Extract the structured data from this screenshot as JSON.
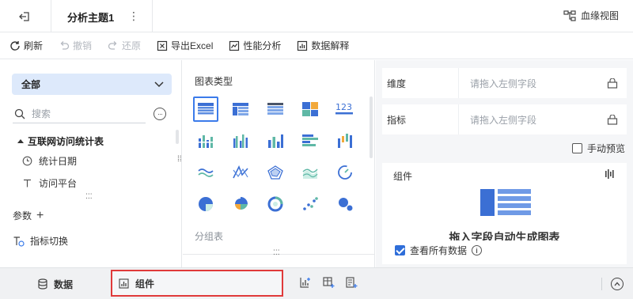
{
  "header": {
    "subject_title": "分析主题1",
    "lineage_label": "血缘视图"
  },
  "toolbar": {
    "refresh": "刷新",
    "undo": "撤销",
    "redo": "还原",
    "export_excel": "导出Excel",
    "performance": "性能分析",
    "data_explain": "数据解释"
  },
  "left_panel": {
    "scope_select": "全部",
    "search_placeholder": "搜索",
    "group_name": "互联网访问统计表",
    "fields": [
      {
        "label": "统计日期",
        "icon": "clock-icon"
      },
      {
        "label": "访问平台",
        "icon": "text-type-icon"
      }
    ],
    "params_label": "参数",
    "metric_switch_label": "指标切换"
  },
  "middle_panel": {
    "chart_type_title": "图表类型",
    "group_table_title": "分组表",
    "chart_types": [
      "table-icon",
      "cross-table-icon",
      "grouped-table-icon",
      "treemap-icon",
      "kpi-number-icon",
      "dot-bar-icon",
      "grouped-bar-icon",
      "stacked-bar-icon",
      "horizontal-bar-icon",
      "waterfall-icon",
      "wave-line-icon",
      "cross-line-icon",
      "radar-icon",
      "area-line-icon",
      "gauge-icon",
      "pie-icon",
      "rose-pie-icon",
      "ring-icon",
      "scatter-icon",
      "bubble-icon"
    ],
    "number_icon_text": "123"
  },
  "right_panel": {
    "dimension_label": "维度",
    "dimension_placeholder": "请拖入左侧字段",
    "metric_label": "指标",
    "metric_placeholder": "请拖入左侧字段",
    "manual_preview_label": "手动预览",
    "widget_title": "组件",
    "hint_text": "拖入字段自动生成图表",
    "view_all_label": "查看所有数据"
  },
  "bottom_bar": {
    "data_tab": "数据",
    "widget_tab": "组件"
  },
  "colors": {
    "accent": "#3b7bea",
    "select_bg": "#dde9fb",
    "highlight_border": "#e03a3a"
  }
}
